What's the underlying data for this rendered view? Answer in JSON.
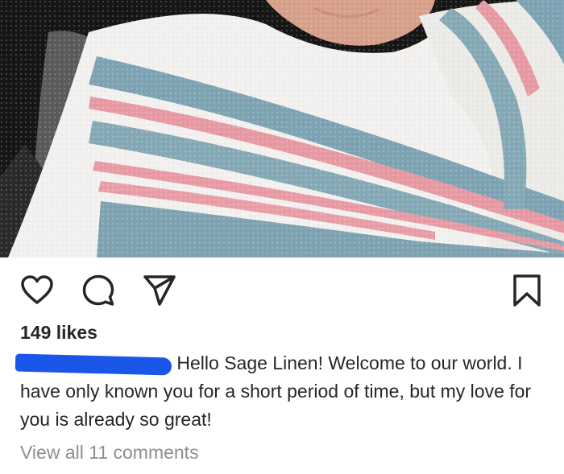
{
  "post": {
    "photo_icon": "swaddled-baby-photo",
    "likes": "149 likes",
    "caption": {
      "username_redacted": "",
      "text": "Hello Sage Linen! Welcome to our world. I have only known you for a short period of time, but my love for you is already so great!"
    },
    "view_comments": "View all 11 comments"
  },
  "actions": {
    "like_icon": "heart-icon",
    "comment_icon": "comment-icon",
    "share_icon": "share-icon",
    "save_icon": "bookmark-icon"
  },
  "colors": {
    "text": "#262626",
    "muted": "#8e8e8e",
    "redaction": "#1a56e8",
    "blanket_blue": "#7ea4b3",
    "blanket_pink": "#e79aa3"
  }
}
